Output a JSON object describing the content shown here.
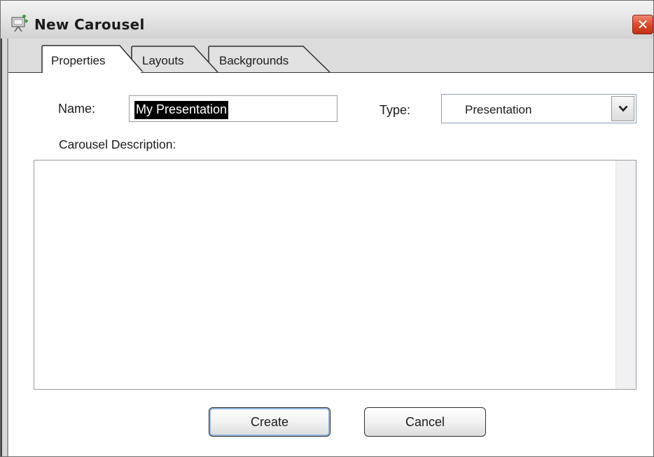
{
  "window": {
    "title": "New Carousel",
    "close_glyph": "✕",
    "icon": "carousel-app-icon"
  },
  "tabs": [
    {
      "label": "Properties",
      "active": true
    },
    {
      "label": "Layouts",
      "active": false
    },
    {
      "label": "Backgrounds",
      "active": false
    }
  ],
  "form": {
    "name_label": "Name:",
    "name_value": "My Presentation",
    "type_label": "Type:",
    "type_value": "Presentation",
    "description_label": "Carousel Description:",
    "description_value": ""
  },
  "buttons": {
    "create": "Create",
    "cancel": "Cancel"
  },
  "colors": {
    "close_button": "#d9462a",
    "selection_bg": "#000000",
    "default_button_ring": "#8fb6e0"
  }
}
